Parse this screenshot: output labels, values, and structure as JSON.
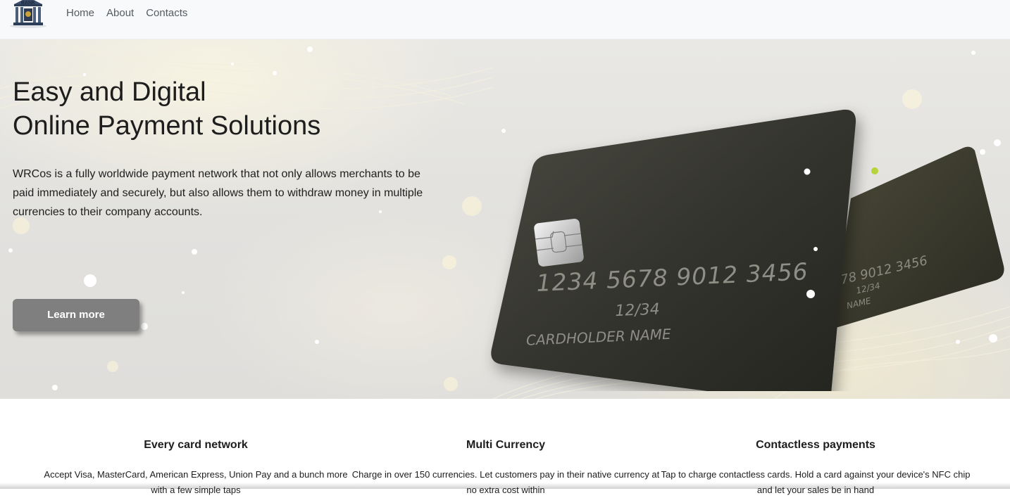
{
  "navbar": {
    "logo_text": "BANK",
    "links": [
      "Home",
      "About",
      "Contacts"
    ]
  },
  "hero": {
    "title_line1": "Easy and Digital",
    "title_line2": "Online Payment Solutions",
    "description": "WRCos is a fully worldwide payment network that not only allows merchants to be paid immediately and securely, but also allows them to withdraw money in multiple currencies to their company accounts.",
    "cta_label": "Learn more",
    "card_front": {
      "number": "1234  5678  9012  3456",
      "expiry": "12/34",
      "holder": "CARDHOLDER NAME"
    },
    "card_back": {
      "number": "78  9012  3456",
      "expiry": "12/34",
      "holder": "NAME"
    }
  },
  "features": [
    {
      "title": "Every card network",
      "text": "Accept Visa, MasterCard, American Express, Union Pay and a bunch more with a few simple taps"
    },
    {
      "title": "Multi Currency",
      "text": "Charge in over 150 currencies. Let customers pay in their native currency at no extra cost within"
    },
    {
      "title": "Contactless payments",
      "text": "Tap to charge contactless cards. Hold a card against your device's NFC chip and let your sales be in hand"
    }
  ],
  "colors": {
    "navbar_bg": "#f8f9fa",
    "nav_link": "#555b61",
    "cta_bg": "#7f7f7f",
    "card_body": "#3a3a33"
  }
}
